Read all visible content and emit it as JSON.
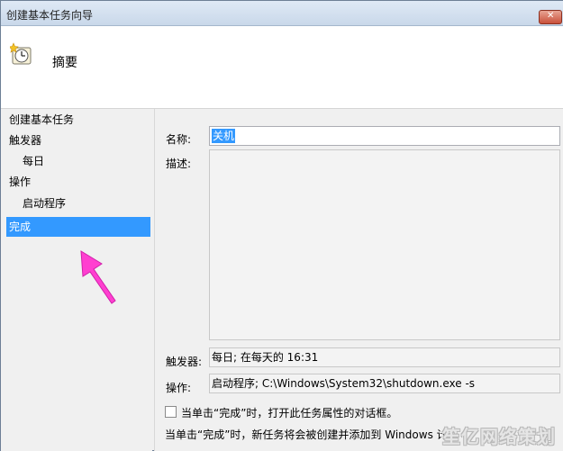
{
  "window": {
    "title": "创建基本任务向导",
    "close_icon": "close-icon"
  },
  "header": {
    "title": "摘要",
    "icon": "clock-icon"
  },
  "sidebar": {
    "items": [
      {
        "label": "创建基本任务"
      },
      {
        "label": "触发器"
      },
      {
        "label": "每日"
      },
      {
        "label": "操作"
      },
      {
        "label": "启动程序"
      },
      {
        "label": "完成",
        "active": true
      }
    ]
  },
  "form": {
    "name_label": "名称:",
    "name_value": "关机",
    "desc_label": "描述:",
    "trigger_label": "触发器:",
    "trigger_value": "每日; 在每天的 16:31",
    "action_label": "操作:",
    "action_value": "启动程序; C:\\Windows\\System32\\shutdown.exe -s"
  },
  "options": {
    "open_properties_label": "当单击“完成”时，打开此任务属性的对话框。",
    "open_properties_checked": false,
    "footer_text": "当单击“完成”时，新任务将会被创建并添加到 Windows 计划"
  },
  "watermark": "笙亿网络策划",
  "colors": {
    "selection": "#3399ff",
    "arrow": "#ff3fd0"
  }
}
